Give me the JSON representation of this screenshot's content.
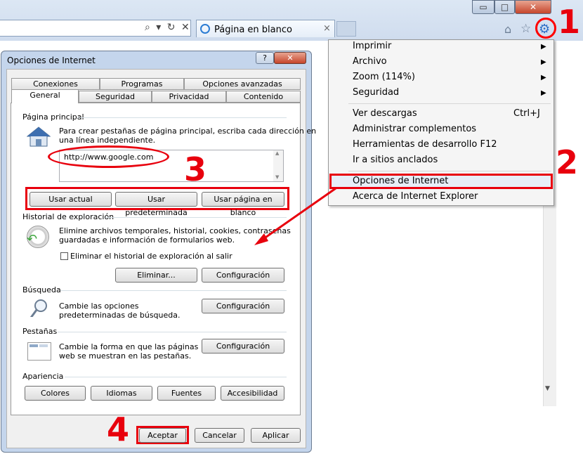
{
  "browser": {
    "tab_title": "Página en blanco",
    "tab_close": "×",
    "addr_icons": "⌕ ▾ ↻ ✕",
    "win_min": "▭",
    "win_max": "□",
    "win_close": "✕",
    "home_icon": "⌂",
    "star_icon": "☆",
    "gear_icon": "⚙"
  },
  "tools_menu": {
    "items": [
      {
        "label": "Imprimir",
        "arrow": "▶"
      },
      {
        "label": "Archivo",
        "arrow": "▶"
      },
      {
        "label": "Zoom (114%)",
        "arrow": "▶"
      },
      {
        "label": "Seguridad",
        "arrow": "▶"
      },
      {
        "label": "Ver descargas",
        "shortcut": "Ctrl+J"
      },
      {
        "label": "Administrar complementos"
      },
      {
        "label": "Herramientas de desarrollo F12"
      },
      {
        "label": "Ir a sitios anclados"
      },
      {
        "label": "Opciones de Internet"
      },
      {
        "label": "Acerca de Internet Explorer"
      }
    ]
  },
  "annotations": {
    "n1": "1",
    "n2": "2",
    "n3": "3",
    "n4": "4"
  },
  "dialog": {
    "title": "Opciones de Internet",
    "help": "?",
    "close": "✕",
    "tabs_back": [
      "Conexiones",
      "Programas",
      "Opciones avanzadas"
    ],
    "tabs_front": [
      "General",
      "Seguridad",
      "Privacidad",
      "Contenido"
    ],
    "homepage": {
      "heading": "Página principal",
      "desc_1": "Para crear pestañas de página principal, escriba cada dirección en",
      "desc_2": "una línea independiente.",
      "url": "http://www.google.com",
      "btn_current": "Usar actual",
      "btn_default": "Usar predeterminada",
      "btn_blank": "Usar página en blanco"
    },
    "history": {
      "heading": "Historial de exploración",
      "desc_1": "Elimine archivos temporales, historial, cookies, contraseñas",
      "desc_2": "guardadas e información de formularios web.",
      "checkbox": "Eliminar el historial de exploración al salir",
      "btn_delete": "Eliminar...",
      "btn_settings": "Configuración"
    },
    "search": {
      "heading": "Búsqueda",
      "desc_1": "Cambie las opciones",
      "desc_2": "predeterminadas de búsqueda.",
      "btn_settings": "Configuración"
    },
    "tabs_group": {
      "heading": "Pestañas",
      "desc_1": "Cambie la forma en que las páginas",
      "desc_2": "web se muestran en las pestañas.",
      "btn_settings": "Configuración"
    },
    "appearance": {
      "heading": "Apariencia",
      "btn_colors": "Colores",
      "btn_languages": "Idiomas",
      "btn_fonts": "Fuentes",
      "btn_accessibility": "Accesibilidad"
    },
    "footer": {
      "ok": "Aceptar",
      "cancel": "Cancelar",
      "apply": "Aplicar"
    }
  }
}
